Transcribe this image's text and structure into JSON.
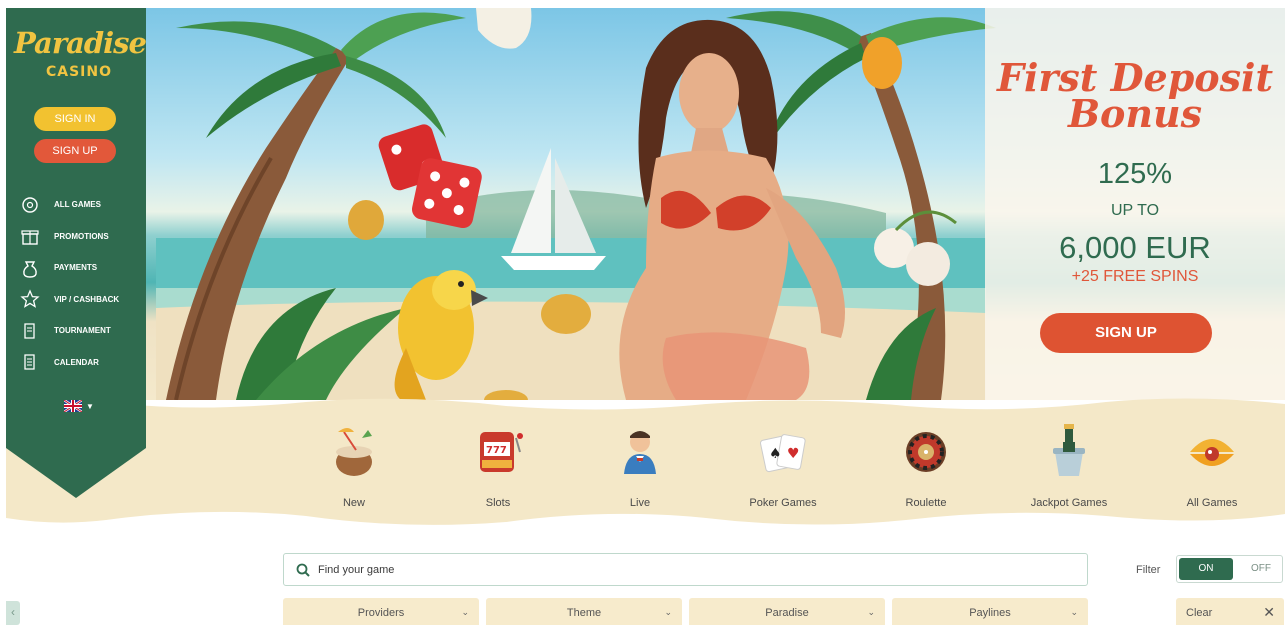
{
  "brand": {
    "script": "Paradise",
    "sub": "CASINO"
  },
  "auth": {
    "signin_label": "SIGN IN",
    "signup_label": "SIGN UP"
  },
  "nav": [
    {
      "label": "ALL GAMES",
      "icon": "all-games-icon"
    },
    {
      "label": "PROMOTIONS",
      "icon": "gift-icon"
    },
    {
      "label": "PAYMENTS",
      "icon": "money-bag-icon"
    },
    {
      "label": "VIP / CASHBACK",
      "icon": "star-icon"
    },
    {
      "label": "TOURNAMENT",
      "icon": "scroll-icon"
    },
    {
      "label": "CALENDAR",
      "icon": "calendar-scroll-icon"
    }
  ],
  "language": {
    "icon": "uk-flag-icon"
  },
  "promo": {
    "title": "First Deposit Bonus",
    "percent": "125%",
    "upto": "UP TO",
    "amount": "6,000 EUR",
    "spins": "+25 FREE SPINS",
    "cta": "SIGN UP"
  },
  "categories": [
    {
      "label": "New",
      "icon": "coconut-cocktail-icon"
    },
    {
      "label": "Slots",
      "icon": "slot-machine-icon"
    },
    {
      "label": "Live",
      "icon": "dealer-icon"
    },
    {
      "label": "Poker Games",
      "icon": "playing-cards-icon"
    },
    {
      "label": "Roulette",
      "icon": "roulette-wheel-icon"
    },
    {
      "label": "Jackpot Games",
      "icon": "champagne-bucket-icon"
    },
    {
      "label": "All Games",
      "icon": "pearl-shell-icon"
    }
  ],
  "search": {
    "placeholder": "Find your game"
  },
  "filter": {
    "label": "Filter",
    "on": "ON",
    "off": "OFF"
  },
  "dropdowns": [
    "Providers",
    "Theme",
    "Paradise",
    "Paylines"
  ],
  "clear": {
    "label": "Clear",
    "icon": "close-icon"
  },
  "colors": {
    "green": "#2f6b4f",
    "yellow": "#f2c230",
    "orange": "#e2583a",
    "sand": "#f7ebcc"
  }
}
